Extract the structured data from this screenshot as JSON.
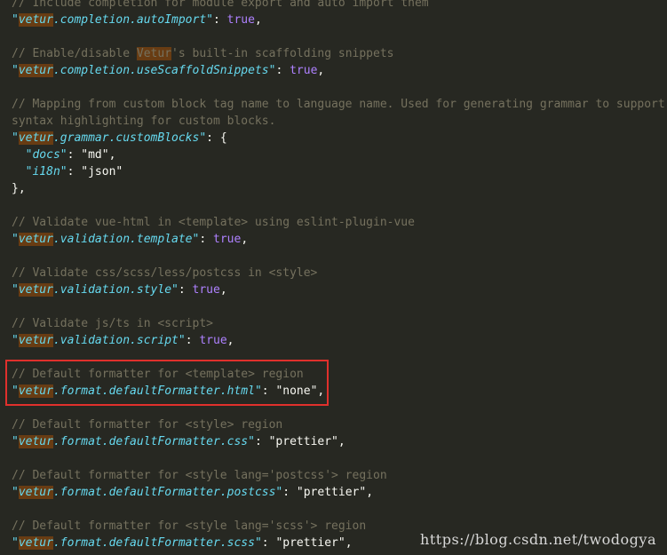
{
  "editor": {
    "lines": [
      {
        "type": "comment",
        "text": "// Include completion for module export and auto import them"
      },
      {
        "type": "setting",
        "hl": "vetur",
        "rest": ".completion.autoImport",
        "value": "true",
        "kind": "bool"
      },
      {
        "type": "blank"
      },
      {
        "type": "comment",
        "pre": "// Enable/disable ",
        "hl": "Vetur",
        "post": "'s built-in scaffolding snippets"
      },
      {
        "type": "setting",
        "hl": "vetur",
        "rest": ".completion.useScaffoldSnippets",
        "value": "true",
        "kind": "bool"
      },
      {
        "type": "blank"
      },
      {
        "type": "comment",
        "text": "// Mapping from custom block tag name to language name. Used for generating grammar to support"
      },
      {
        "type": "comment",
        "text": "syntax highlighting for custom blocks."
      },
      {
        "type": "objopen",
        "hl": "vetur",
        "rest": ".grammar.customBlocks"
      },
      {
        "type": "subkey",
        "key": "docs",
        "value": "\"md\","
      },
      {
        "type": "subkey",
        "key": "i18n",
        "value": "\"json\""
      },
      {
        "type": "objclose",
        "text": "},"
      },
      {
        "type": "blank"
      },
      {
        "type": "comment",
        "text": "// Validate vue-html in <template> using eslint-plugin-vue"
      },
      {
        "type": "setting",
        "hl": "vetur",
        "rest": ".validation.template",
        "value": "true",
        "kind": "bool"
      },
      {
        "type": "blank"
      },
      {
        "type": "comment",
        "text": "// Validate css/scss/less/postcss in <style>"
      },
      {
        "type": "setting",
        "hl": "vetur",
        "rest": ".validation.style",
        "value": "true",
        "kind": "bool"
      },
      {
        "type": "blank"
      },
      {
        "type": "comment",
        "text": "// Validate js/ts in <script>"
      },
      {
        "type": "setting",
        "hl": "vetur",
        "rest": ".validation.script",
        "value": "true",
        "kind": "bool"
      },
      {
        "type": "blank"
      },
      {
        "type": "comment",
        "text": "// Default formatter for <template> region"
      },
      {
        "type": "setting",
        "hl": "vetur",
        "rest": ".format.defaultFormatter.html",
        "value": "\"none\"",
        "kind": "str"
      },
      {
        "type": "blank"
      },
      {
        "type": "comment",
        "text": "// Default formatter for <style> region"
      },
      {
        "type": "setting",
        "hl": "vetur",
        "rest": ".format.defaultFormatter.css",
        "value": "\"prettier\"",
        "kind": "str"
      },
      {
        "type": "blank"
      },
      {
        "type": "comment",
        "text": "// Default formatter for <style lang='postcss'> region"
      },
      {
        "type": "setting",
        "hl": "vetur",
        "rest": ".format.defaultFormatter.postcss",
        "value": "\"prettier\"",
        "kind": "str"
      },
      {
        "type": "blank"
      },
      {
        "type": "comment",
        "text": "// Default formatter for <style lang='scss'> region"
      },
      {
        "type": "setting",
        "hl": "vetur",
        "rest": ".format.defaultFormatter.scss",
        "value": "\"prettier\"",
        "kind": "str"
      }
    ]
  },
  "watermark": "https://blog.csdn.net/twodogya",
  "colors": {
    "background": "#272822",
    "comment": "#75715e",
    "key": "#66d9ef",
    "bool": "#ae81ff",
    "highlight": "#683c13",
    "box": "#e0302c"
  }
}
